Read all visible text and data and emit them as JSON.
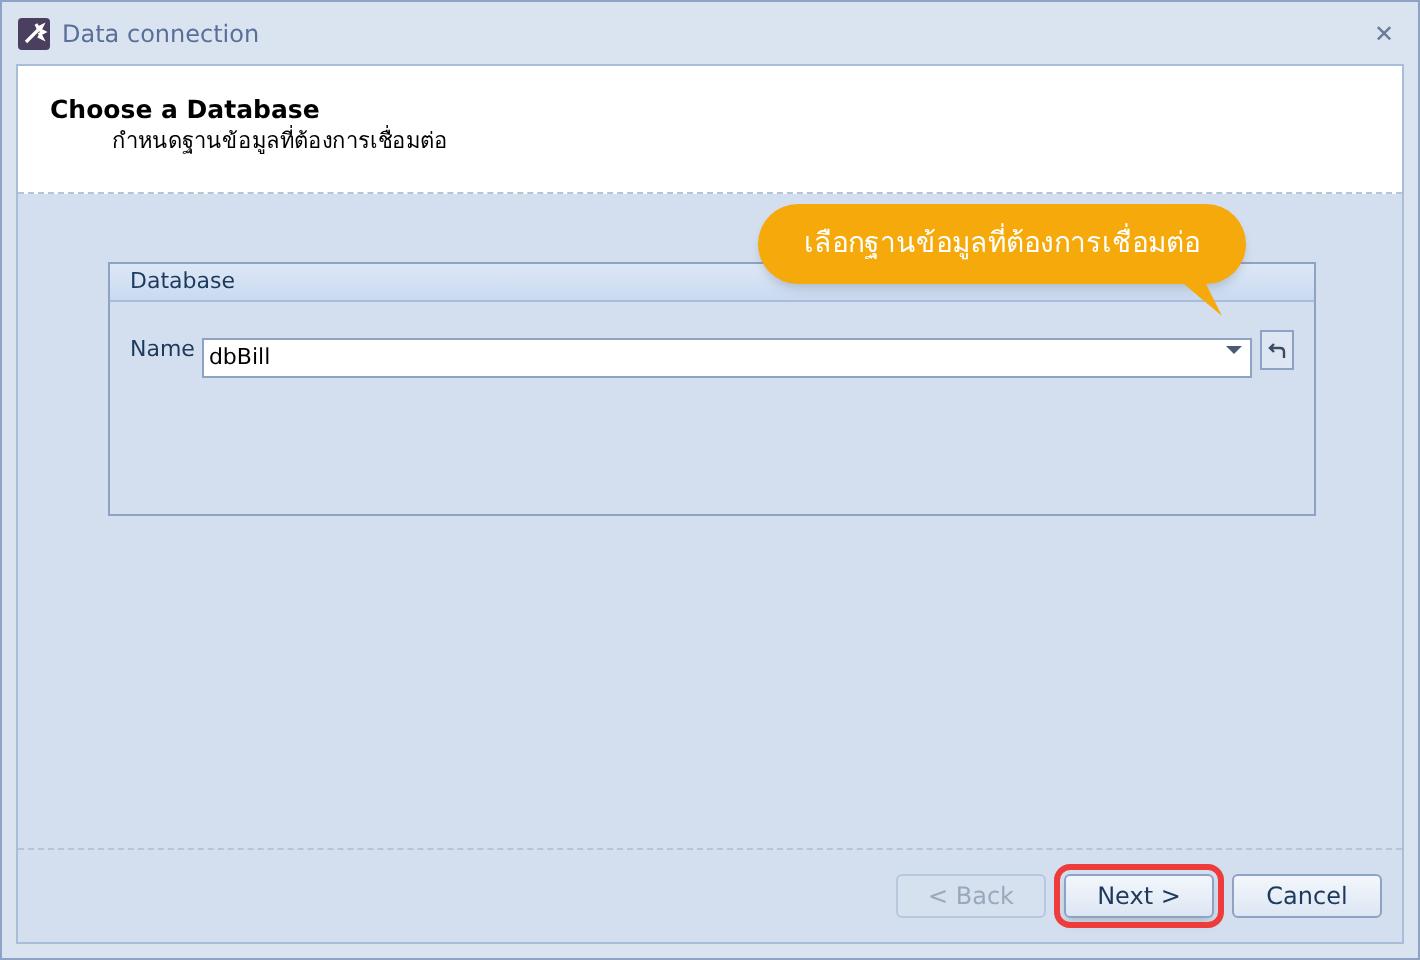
{
  "window": {
    "title": "Data connection",
    "close": "✕"
  },
  "header": {
    "title": "Choose a Database",
    "subtitle": "กำหนดฐานข้อมูลที่ต้องการเชื่อมต่อ"
  },
  "callout": {
    "text": "เลือกฐานข้อมูลที่ต้องการเชื่อมต่อ"
  },
  "group": {
    "title": "Database",
    "field": {
      "label": "Name",
      "value": "dbBill"
    }
  },
  "buttons": [
    {
      "label": "< Back",
      "disabled": true,
      "highlighted": false
    },
    {
      "label": "Next >",
      "disabled": false,
      "highlighted": true
    },
    {
      "label": "Cancel",
      "disabled": false,
      "highlighted": false
    }
  ]
}
